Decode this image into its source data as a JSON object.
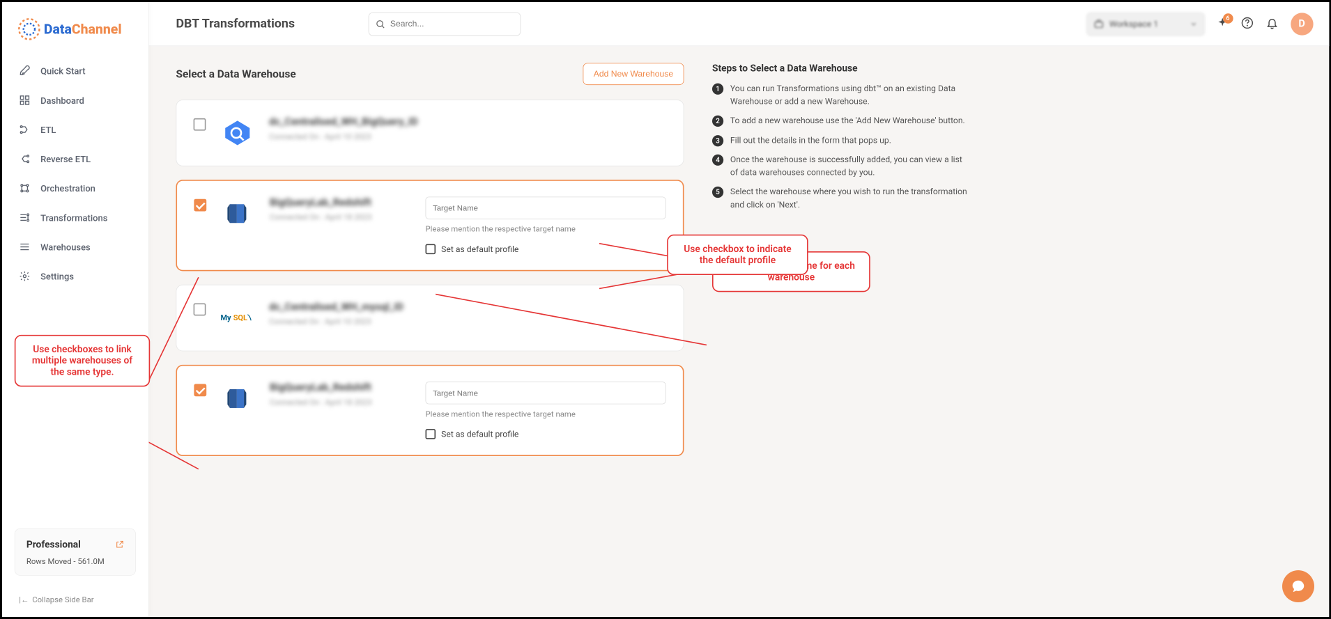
{
  "brand": {
    "text1": "Data",
    "text2": "Channel"
  },
  "sidebar": {
    "items": [
      {
        "label": "Quick Start"
      },
      {
        "label": "Dashboard"
      },
      {
        "label": "ETL"
      },
      {
        "label": "Reverse ETL"
      },
      {
        "label": "Orchestration"
      },
      {
        "label": "Transformations"
      },
      {
        "label": "Warehouses"
      },
      {
        "label": "Settings"
      }
    ],
    "plan": {
      "title": "Professional",
      "rows": "Rows Moved - 561.0M"
    },
    "collapse": "Collapse Side Bar"
  },
  "header": {
    "title": "DBT Transformations",
    "search_placeholder": "Search...",
    "workspace": "Workspace 1",
    "badge": "6",
    "avatar": "D"
  },
  "main": {
    "section_title": "Select a Data Warehouse",
    "add_button": "Add New Warehouse",
    "warehouses": [
      {
        "name": "dc_Centralised_WH_BigQuery_ID",
        "date": "Connected On : April 10 2023",
        "selected": false
      },
      {
        "name": "BigQueryLab_Redshift",
        "date": "Connected On : April 18 2023",
        "selected": true,
        "target_placeholder": "Target Name",
        "helper": "Please mention the respective target name",
        "default_label": "Set as default profile"
      },
      {
        "name": "dc_Centralised_WH_mysql_ID",
        "date": "Connected On : April 10 2023",
        "selected": false
      },
      {
        "name": "BigQueryLab_Redshift",
        "date": "Connected On : April 18 2023",
        "selected": true,
        "target_placeholder": "Target Name",
        "helper": "Please mention the respective target name",
        "default_label": "Set as default profile"
      }
    ]
  },
  "steps": {
    "title": "Steps to Select a Data Warehouse",
    "items": [
      "You can run Transformations using dbt™ on an existing Data Warehouse or add a new Warehouse.",
      "To add a new warehouse use the 'Add New Warehouse' button.",
      "Fill out the details in the form that pops up.",
      "Once the warehouse is successfully added, you can view a list of data warehouses connected by you.",
      "Select the warehouse where you wish to run the transformation and click on 'Next'."
    ]
  },
  "annotations": {
    "checkbox": "Use checkboxes to link multiple warehouses of the same type.",
    "target": "Mention target name for each warehouse",
    "default": "Use checkbox to indicate the default profile"
  }
}
